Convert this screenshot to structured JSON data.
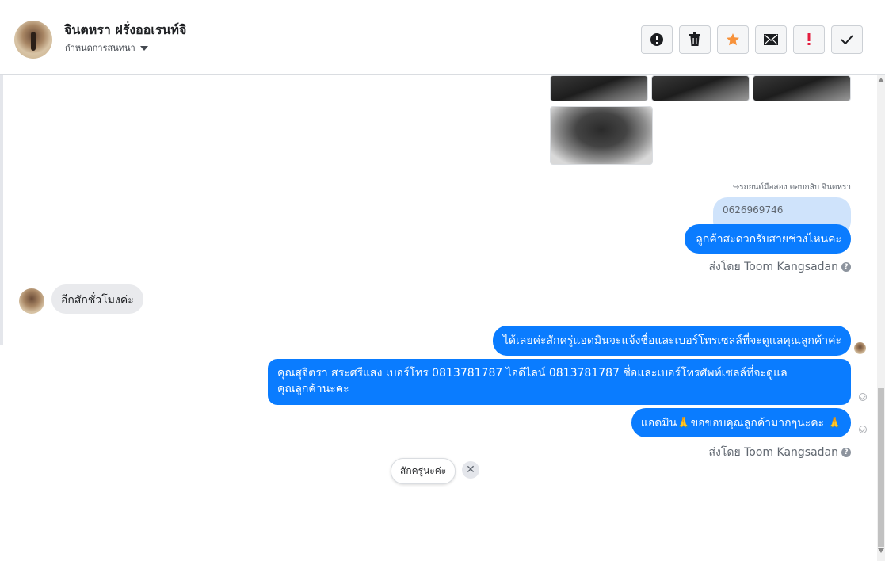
{
  "contact": {
    "name": "จินตหรา ฝรั่งออเรนท์จิ",
    "label_action": "กำหนดการสนทนา"
  },
  "toolbar": {
    "buttons": [
      {
        "name": "report",
        "icon": "exclamation-circle-icon"
      },
      {
        "name": "delete",
        "icon": "trash-icon"
      },
      {
        "name": "star",
        "icon": "star-icon",
        "color": "#f7923b"
      },
      {
        "name": "mark-unread",
        "icon": "envelope-icon"
      },
      {
        "name": "important",
        "icon": "exclamation-icon",
        "color": "#e41e3f"
      },
      {
        "name": "done",
        "icon": "check-icon"
      }
    ]
  },
  "thread": {
    "reply_context": "↪รถยนต์มือสอง ตอบกลับ จินตหรา",
    "quoted_text": "0626969746",
    "messages": [
      {
        "from": "page",
        "text": "ลูกค้าสะดวกรับสายช่วงไหนคะ"
      },
      {
        "from": "customer",
        "text": "อีกสักชั่วโมงค่ะ"
      },
      {
        "from": "page",
        "text": "ได้เลยค่ะสักครู่แอดมินจะแจ้งชื่อและเบอร์โทรเซลล์ที่จะดูแลคุณลูกค้าค่ะ"
      },
      {
        "from": "page",
        "line1": "คุณสุจิตรา สระศรีแสง     เบอร์โทร 0813781787  ไอดีไลน์ 0813781787  ชื่อและเบอร์โทรศัพท์เซลล์ที่จะดูแล",
        "line2": "คุณลูกค้านะคะ"
      },
      {
        "from": "page",
        "text": "แอดมิน🙏ขอขอบคุณลูกค้ามากๆนะคะ 🙏"
      }
    ],
    "sent_by_1": "ส่งโดย Toom Kangsadan",
    "sent_by_2": "ส่งโดย Toom Kangsadan",
    "help_glyph": "?"
  },
  "quick_reply": {
    "label": "สักครู่นะค่ะ",
    "close_glyph": "✕"
  }
}
